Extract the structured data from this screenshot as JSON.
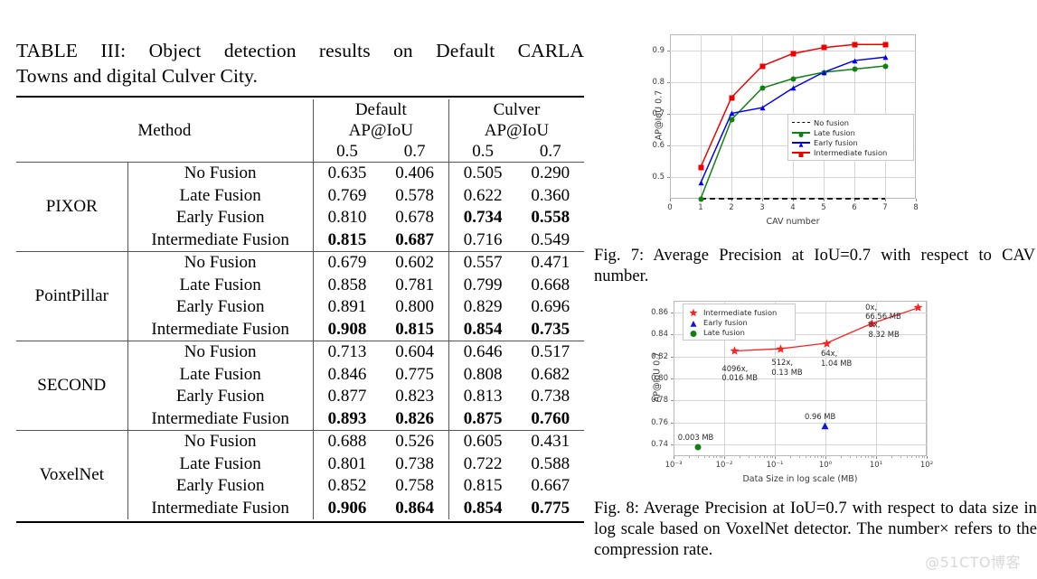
{
  "table": {
    "caption_line1": "TABLE III: Object detection results on Default CARLA",
    "caption_line2": "Towns and digital Culver City.",
    "method_header": "Method",
    "groups": [
      {
        "name": "Default",
        "metric": "AP@IoU",
        "sub": [
          "0.5",
          "0.7"
        ]
      },
      {
        "name": "Culver",
        "metric": "AP@IoU",
        "sub": [
          "0.5",
          "0.7"
        ]
      }
    ],
    "blocks": [
      {
        "detector": "PIXOR",
        "rows": [
          {
            "fusion": "No Fusion",
            "values": [
              "0.635",
              "0.406",
              "0.505",
              "0.290"
            ],
            "bold": [
              false,
              false,
              false,
              false
            ]
          },
          {
            "fusion": "Late Fusion",
            "values": [
              "0.769",
              "0.578",
              "0.622",
              "0.360"
            ],
            "bold": [
              false,
              false,
              false,
              false
            ]
          },
          {
            "fusion": "Early Fusion",
            "values": [
              "0.810",
              "0.678",
              "0.734",
              "0.558"
            ],
            "bold": [
              false,
              false,
              true,
              true
            ]
          },
          {
            "fusion": "Intermediate Fusion",
            "values": [
              "0.815",
              "0.687",
              "0.716",
              "0.549"
            ],
            "bold": [
              true,
              true,
              false,
              false
            ]
          }
        ]
      },
      {
        "detector": "PointPillar",
        "rows": [
          {
            "fusion": "No Fusion",
            "values": [
              "0.679",
              "0.602",
              "0.557",
              "0.471"
            ],
            "bold": [
              false,
              false,
              false,
              false
            ]
          },
          {
            "fusion": "Late Fusion",
            "values": [
              "0.858",
              "0.781",
              "0.799",
              "0.668"
            ],
            "bold": [
              false,
              false,
              false,
              false
            ]
          },
          {
            "fusion": "Early Fusion",
            "values": [
              "0.891",
              "0.800",
              "0.829",
              "0.696"
            ],
            "bold": [
              false,
              false,
              false,
              false
            ]
          },
          {
            "fusion": "Intermediate Fusion",
            "values": [
              "0.908",
              "0.815",
              "0.854",
              "0.735"
            ],
            "bold": [
              true,
              true,
              true,
              true
            ]
          }
        ]
      },
      {
        "detector": "SECOND",
        "rows": [
          {
            "fusion": "No Fusion",
            "values": [
              "0.713",
              "0.604",
              "0.646",
              "0.517"
            ],
            "bold": [
              false,
              false,
              false,
              false
            ]
          },
          {
            "fusion": "Late Fusion",
            "values": [
              "0.846",
              "0.775",
              "0.808",
              "0.682"
            ],
            "bold": [
              false,
              false,
              false,
              false
            ]
          },
          {
            "fusion": "Early Fusion",
            "values": [
              "0.877",
              "0.823",
              "0.813",
              "0.738"
            ],
            "bold": [
              false,
              false,
              false,
              false
            ]
          },
          {
            "fusion": "Intermediate Fusion",
            "values": [
              "0.893",
              "0.826",
              "0.875",
              "0.760"
            ],
            "bold": [
              true,
              true,
              true,
              true
            ]
          }
        ]
      },
      {
        "detector": "VoxelNet",
        "rows": [
          {
            "fusion": "No Fusion",
            "values": [
              "0.688",
              "0.526",
              "0.605",
              "0.431"
            ],
            "bold": [
              false,
              false,
              false,
              false
            ]
          },
          {
            "fusion": "Late Fusion",
            "values": [
              "0.801",
              "0.738",
              "0.722",
              "0.588"
            ],
            "bold": [
              false,
              false,
              false,
              false
            ]
          },
          {
            "fusion": "Early Fusion",
            "values": [
              "0.852",
              "0.758",
              "0.815",
              "0.667"
            ],
            "bold": [
              false,
              false,
              false,
              false
            ]
          },
          {
            "fusion": "Intermediate Fusion",
            "values": [
              "0.906",
              "0.864",
              "0.854",
              "0.775"
            ],
            "bold": [
              true,
              true,
              true,
              true
            ]
          }
        ]
      }
    ]
  },
  "fig7": {
    "caption": "Fig. 7: Average Precision at IoU=0.7 with respect to CAV number.",
    "colors": {
      "no_fusion": "#000000",
      "late_fusion": "#108010",
      "early_fusion": "#0000ee",
      "intermediate_fusion": "#ee0000"
    }
  },
  "fig8": {
    "caption": "Fig. 8: Average Precision at IoU=0.7 with respect to data size in log scale based on VoxelNet detector. The number× refers to the compression rate.",
    "colors": {
      "intermediate_fusion": "#ff2020",
      "early_fusion": "#1414dc",
      "late_fusion": "#148014"
    }
  },
  "chart_data": [
    {
      "id": "fig7",
      "type": "line",
      "title": "",
      "xlabel": "CAV number",
      "ylabel": "AP@IoU 0.7",
      "xlim": [
        0,
        8
      ],
      "ylim": [
        0.43,
        0.95
      ],
      "xticks": [
        "0",
        "1",
        "2",
        "3",
        "4",
        "5",
        "6",
        "7",
        "8"
      ],
      "yticks": [
        "0.5",
        "0.6",
        "0.7",
        "0.8",
        "0.9"
      ],
      "grid": true,
      "legend_position": "center-right",
      "x": [
        1,
        2,
        3,
        4,
        5,
        6,
        7
      ],
      "series": [
        {
          "name": "No fusion",
          "style": "dashed",
          "marker": "none",
          "color": "#000000",
          "values": [
            0.43,
            0.43,
            0.43,
            0.43,
            0.43,
            0.43,
            0.43
          ]
        },
        {
          "name": "Late fusion",
          "style": "solid",
          "marker": "circle",
          "color": "#108010",
          "values": [
            0.43,
            0.68,
            0.78,
            0.81,
            0.83,
            0.84,
            0.85
          ]
        },
        {
          "name": "Early fusion",
          "style": "solid",
          "marker": "triangle",
          "color": "#0000ee",
          "values": [
            0.48,
            0.7,
            0.718,
            0.78,
            0.83,
            0.867,
            0.878
          ]
        },
        {
          "name": "Intermediate fusion",
          "style": "solid",
          "marker": "square",
          "color": "#ee0000",
          "values": [
            0.53,
            0.75,
            0.85,
            0.889,
            0.908,
            0.918,
            0.918
          ]
        }
      ]
    },
    {
      "id": "fig8",
      "type": "scatter",
      "title": "",
      "xlabel": "Data Size in log scale (MB)",
      "ylabel": "AP@IoU 0.7",
      "xlim": [
        0.001,
        100
      ],
      "xscale": "log",
      "ylim": [
        0.7295,
        0.8705
      ],
      "xticks": [
        "10⁻³",
        "10⁻²",
        "10⁻¹",
        "10⁰",
        "10¹",
        "10²"
      ],
      "yticks": [
        "0.74",
        "0.76",
        "0.78",
        "0.80",
        "0.82",
        "0.84",
        "0.86"
      ],
      "grid": true,
      "legend_position": "upper-left",
      "series": [
        {
          "name": "Intermediate fusion",
          "marker": "star",
          "color": "#ff2020",
          "connected": true,
          "points": [
            {
              "x": 0.016,
              "y": 0.825,
              "label": "4096x,\n0.016 MB"
            },
            {
              "x": 0.13,
              "y": 0.827,
              "label": "512x,\n0.13 MB"
            },
            {
              "x": 1.04,
              "y": 0.832,
              "label": "64x,\n1.04 MB"
            },
            {
              "x": 8.32,
              "y": 0.85,
              "label": "8x,\n8.32 MB"
            },
            {
              "x": 66.56,
              "y": 0.864,
              "label": "0x,\n66.56 MB"
            }
          ]
        },
        {
          "name": "Early fusion",
          "marker": "triangle",
          "color": "#1414dc",
          "connected": false,
          "points": [
            {
              "x": 0.96,
              "y": 0.757,
              "label": "0.96 MB"
            }
          ]
        },
        {
          "name": "Late fusion",
          "marker": "circle",
          "color": "#148014",
          "connected": false,
          "points": [
            {
              "x": 0.003,
              "y": 0.738,
              "label": "0.003 MB"
            }
          ]
        }
      ]
    }
  ],
  "watermark": "@51CTO博客"
}
